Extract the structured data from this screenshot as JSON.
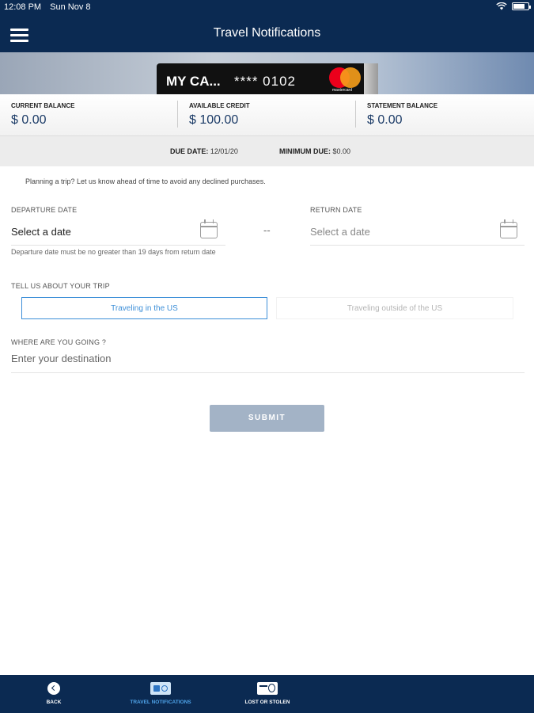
{
  "status_bar": {
    "time": "12:08 PM",
    "date": "Sun Nov 8"
  },
  "header": {
    "title": "Travel Notifications",
    "menu_icon": "hamburger-menu-icon"
  },
  "card": {
    "name": "MY CA...",
    "number": "**** 0102",
    "network_logo": "mastercard-logo",
    "network_text": "mastercard"
  },
  "balances": [
    {
      "label": "CURRENT BALANCE",
      "value": "$ 0.00"
    },
    {
      "label": "AVAILABLE CREDIT",
      "value": "$ 100.00"
    },
    {
      "label": "STATEMENT BALANCE",
      "value": "$ 0.00"
    }
  ],
  "due": {
    "due_date_label": "DUE DATE:",
    "due_date_value": "12/01/20",
    "minimum_due_label": "MINIMUM DUE:",
    "minimum_due_value": "$0.00"
  },
  "form": {
    "intro": "Planning a trip? Let us know ahead of time to avoid any declined purchases.",
    "departure": {
      "label": "DEPARTURE DATE",
      "value": "Select a date",
      "hint": "Departure date must be no greater than 19 days from return date"
    },
    "separator": "--",
    "return": {
      "label": "RETURN DATE",
      "value": "Select a date"
    },
    "trip": {
      "label": "TELL US ABOUT YOUR TRIP",
      "options": [
        "Traveling in the US",
        "Traveling outside of the US"
      ],
      "selected": "Traveling in the US"
    },
    "destination": {
      "label": "WHERE ARE YOU GOING ?",
      "placeholder": "Enter your destination",
      "value": ""
    },
    "submit": "SUBMIT"
  },
  "bottom_nav": [
    {
      "label": "BACK",
      "icon": "back-arrow-icon"
    },
    {
      "label": "TRAVEL NOTIFICATIONS",
      "icon": "travel-notification-icon",
      "active": true
    },
    {
      "label": "LOST OR STOLEN",
      "icon": "lost-card-icon"
    }
  ],
  "colors": {
    "navy": "#0b2a52",
    "accent": "#3d8fd8",
    "submit_disabled": "#a3b3c6"
  }
}
